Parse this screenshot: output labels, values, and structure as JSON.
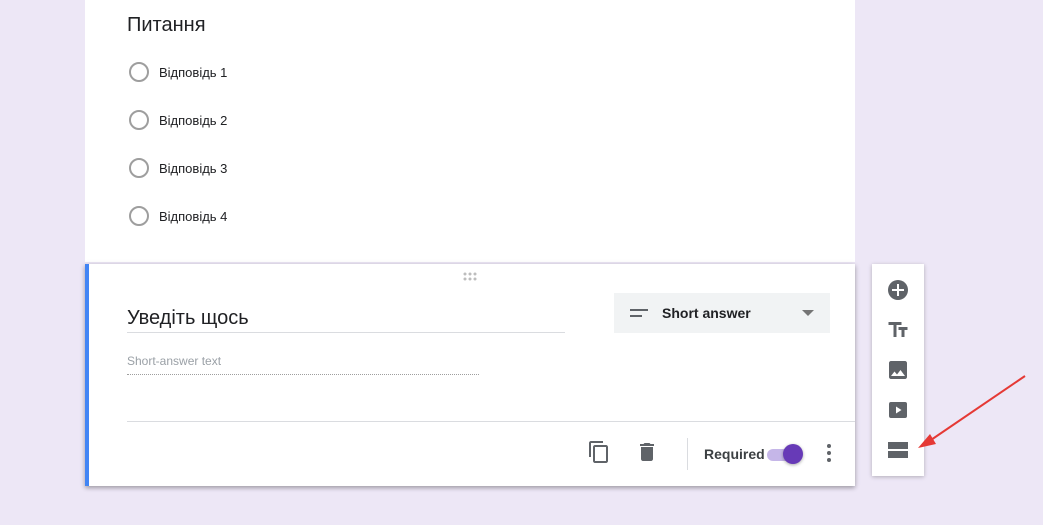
{
  "previous_question": {
    "title": "Питання",
    "options": [
      {
        "label": "Відповідь 1"
      },
      {
        "label": "Відповідь 2"
      },
      {
        "label": "Відповідь 3"
      },
      {
        "label": "Відповідь 4"
      }
    ]
  },
  "active_question": {
    "title": "Уведіть щось",
    "answer_placeholder": "Short-answer text",
    "type_label": "Short answer",
    "required_label": "Required",
    "required": true
  },
  "side_toolbar": {
    "tools": [
      {
        "icon": "add-circle-icon"
      },
      {
        "icon": "title-text-icon"
      },
      {
        "icon": "image-icon"
      },
      {
        "icon": "video-icon"
      },
      {
        "icon": "section-icon"
      }
    ]
  },
  "colors": {
    "background": "#ede7f6",
    "accent_bar": "#4285f4",
    "toggle_on": "#673ab7",
    "arrow": "#e53935"
  }
}
